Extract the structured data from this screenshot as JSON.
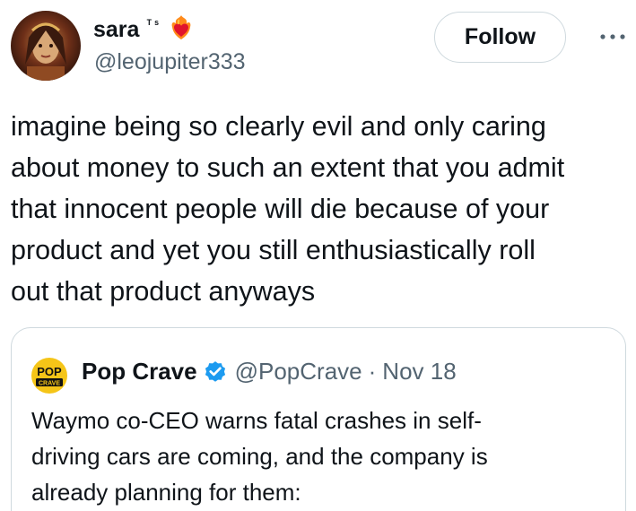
{
  "author": {
    "display_name": "sara",
    "name_badge_text": "ᵀˢ",
    "badge_emoji": "fire-heart-icon",
    "handle": "@leojupiter333",
    "follow_label": "Follow",
    "more_icon": "more-horizontal-icon"
  },
  "tweet": {
    "text": "imagine being so clearly evil and only caring\nabout money to such an extent that you admit\nthat innocent people will die because of your\nproduct and yet you still enthusiastically roll\nout that product anyways"
  },
  "quoted_tweet": {
    "avatar_text_top": "POP",
    "avatar_text_bottom": "CRAVE",
    "display_name": "Pop Crave",
    "verified_icon": "verified-badge-icon",
    "handle": "@PopCrave",
    "separator": "·",
    "date": "Nov 18",
    "text": "Waymo co-CEO warns fatal crashes in self-\ndriving cars are coming, and the company is\nalready planning for them:"
  },
  "colors": {
    "text_primary": "#0f1419",
    "text_secondary": "#536471",
    "border": "#cfd9de",
    "verified_blue": "#1d9bf0",
    "pop_crave_yellow": "#f5c518"
  }
}
